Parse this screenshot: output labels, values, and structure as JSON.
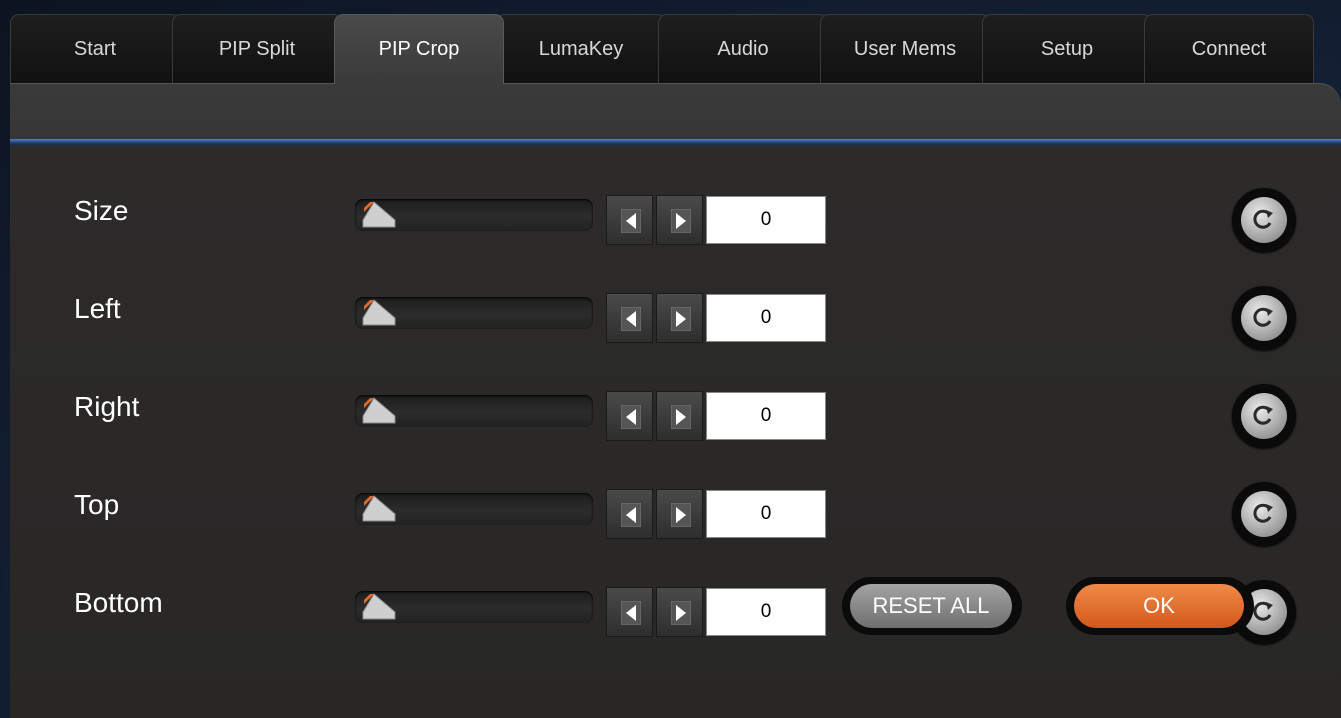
{
  "tabs": [
    {
      "label": "Start"
    },
    {
      "label": "PIP Split"
    },
    {
      "label": "PIP Crop",
      "active": true
    },
    {
      "label": "LumaKey"
    },
    {
      "label": "Audio"
    },
    {
      "label": "User Mems"
    },
    {
      "label": "Setup"
    },
    {
      "label": "Connect"
    }
  ],
  "rows": [
    {
      "label": "Size",
      "value": "0",
      "slider_level": 0
    },
    {
      "label": "Left",
      "value": "0",
      "slider_level": 0
    },
    {
      "label": "Right",
      "value": "0",
      "slider_level": 0
    },
    {
      "label": "Top",
      "value": "0",
      "slider_level": 0
    },
    {
      "label": "Bottom",
      "value": "0",
      "slider_level": 0
    }
  ],
  "icons": {
    "decrement": "triangle-left-icon",
    "increment": "triangle-right-icon",
    "reset": "reset-circular-arrow-icon"
  },
  "buttons": {
    "reset_all_label": "RESET ALL",
    "ok_label": "OK"
  },
  "colors": {
    "accent_orange": "#e06a2a",
    "divider_blue": "#2f5496",
    "panel": "#2e2d2c"
  }
}
